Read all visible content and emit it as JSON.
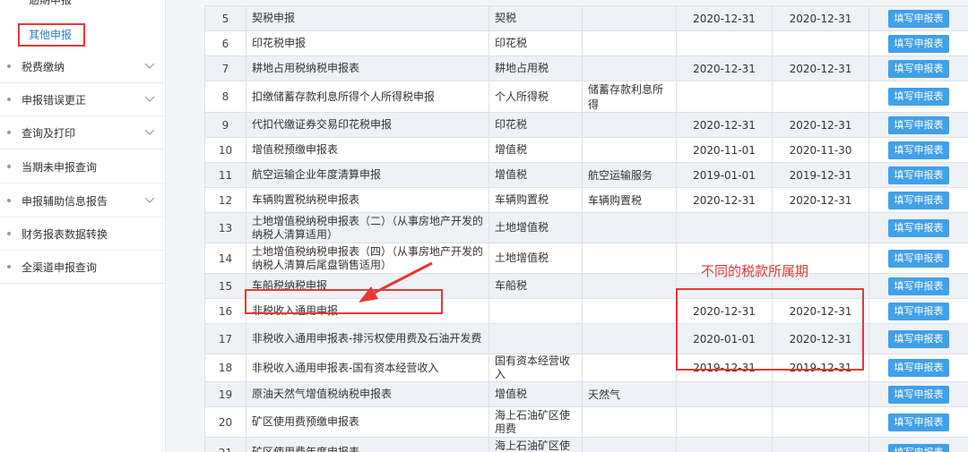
{
  "sidebar": {
    "partial_item": "逾期申报",
    "active_item": "其他申报",
    "items": [
      {
        "label": "税费缴纳",
        "chevron": true
      },
      {
        "label": "申报错误更正",
        "chevron": true
      },
      {
        "label": "查询及打印",
        "chevron": true
      },
      {
        "label": "当期未申报查询",
        "chevron": false
      },
      {
        "label": "申报辅助信息报告",
        "chevron": true
      },
      {
        "label": "财务报表数据转换",
        "chevron": false
      },
      {
        "label": "全渠道申报查询",
        "chevron": false
      }
    ]
  },
  "table": {
    "action_label": "填写申报表",
    "rows": [
      {
        "no": "5",
        "name": "契税申报",
        "tax": "契税",
        "item": "",
        "start": "2020-12-31",
        "end": "2020-12-31"
      },
      {
        "no": "6",
        "name": "印花税申报",
        "tax": "印花税",
        "item": "",
        "start": "",
        "end": ""
      },
      {
        "no": "7",
        "name": "耕地占用税纳税申报表",
        "tax": "耕地占用税",
        "item": "",
        "start": "2020-12-31",
        "end": "2020-12-31"
      },
      {
        "no": "8",
        "name": "扣缴储蓄存款利息所得个人所得税申报",
        "tax": "个人所得税",
        "item": "储蓄存款利息所得",
        "start": "",
        "end": ""
      },
      {
        "no": "9",
        "name": "代扣代缴证券交易印花税申报",
        "tax": "印花税",
        "item": "",
        "start": "2020-12-31",
        "end": "2020-12-31"
      },
      {
        "no": "10",
        "name": "增值税预缴申报表",
        "tax": "增值税",
        "item": "",
        "start": "2020-11-01",
        "end": "2020-11-30"
      },
      {
        "no": "11",
        "name": "航空运输企业年度清算申报",
        "tax": "增值税",
        "item": "航空运输服务",
        "start": "2019-01-01",
        "end": "2019-12-31"
      },
      {
        "no": "12",
        "name": "车辆购置税纳税申报表",
        "tax": "车辆购置税",
        "item": "车辆购置税",
        "start": "2020-12-31",
        "end": "2020-12-31"
      },
      {
        "no": "13",
        "name": "土地增值税纳税申报表（二）（从事房地产开发的纳税人清算适用）",
        "tax": "土地增值税",
        "item": "",
        "start": "",
        "end": ""
      },
      {
        "no": "14",
        "name": "土地增值税纳税申报表（四）（从事房地产开发的纳税人清算后尾盘销售适用）",
        "tax": "土地增值税",
        "item": "",
        "start": "",
        "end": ""
      },
      {
        "no": "15",
        "name": "车船税纳税申报",
        "tax": "车船税",
        "item": "",
        "start": "",
        "end": ""
      },
      {
        "no": "16",
        "name": "非税收入通用申报",
        "tax": "",
        "item": "",
        "start": "2020-12-31",
        "end": "2020-12-31"
      },
      {
        "no": "17",
        "name": "非税收入通用申报表-排污权使用费及石油开发费",
        "tax": "",
        "item": "",
        "start": "2020-01-01",
        "end": "2020-12-31"
      },
      {
        "no": "18",
        "name": "非税收入通用申报表-国有资本经营收入",
        "tax": "国有资本经营收入",
        "item": "",
        "start": "2019-12-31",
        "end": "2019-12-31"
      },
      {
        "no": "19",
        "name": "原油天然气增值税纳税申报表",
        "tax": "增值税",
        "item": "天然气",
        "start": "",
        "end": ""
      },
      {
        "no": "20",
        "name": "矿区使用费预缴申报表",
        "tax": "海上石油矿区使用费",
        "item": "",
        "start": "",
        "end": ""
      },
      {
        "no": "21",
        "name": "矿区使用费年度申报表",
        "tax": "海上石油矿区使用费",
        "item": "",
        "start": "",
        "end": ""
      }
    ]
  },
  "annotation": {
    "text": "不同的税款所属期",
    "color": "#e53935"
  }
}
